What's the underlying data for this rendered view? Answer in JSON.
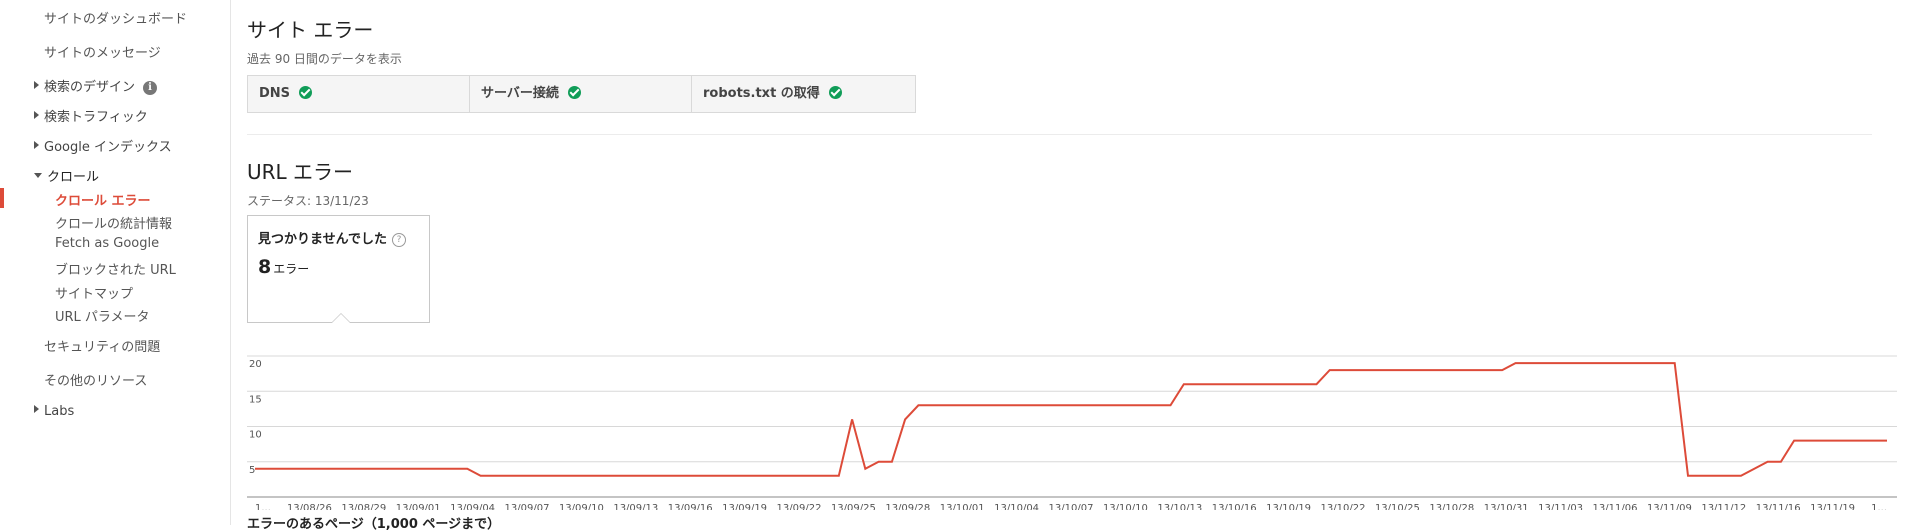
{
  "sidebar": {
    "top_items": [
      "サイトのダッシュボード",
      "サイトのメッセージ"
    ],
    "search_design": "検索のデザイン",
    "search_traffic": "検索トラフィック",
    "google_index": "Google インデックス",
    "crawl": "クロール",
    "crawl_sub": [
      "クロール エラー",
      "クロールの統計情報",
      "Fetch as Google",
      "ブロックされた URL",
      "サイトマップ",
      "URL パラメータ"
    ],
    "security": "セキュリティの問題",
    "other_resources": "その他のリソース",
    "labs": "Labs"
  },
  "site_errors": {
    "title": "サイト エラー",
    "subtitle": "過去 90 日間のデータを表示",
    "cells": [
      "DNS",
      "サーバー接続",
      "robots.txt の取得"
    ]
  },
  "url_errors": {
    "title": "URL エラー",
    "status": "ステータス: 13/11/23",
    "card_title": "見つかりませんでした",
    "card_count": "8",
    "card_count_unit": "エラー"
  },
  "colors": {
    "line": "#dd4b39",
    "active": "#dd4b39",
    "check": "#109d58"
  },
  "chart_data": {
    "type": "line",
    "ylim": [
      0,
      20
    ],
    "yticks": [
      5,
      10,
      15,
      20
    ],
    "xtick_labels": [
      "1...",
      "13/08/26",
      "13/08/29",
      "13/09/01",
      "13/09/04",
      "13/09/07",
      "13/09/10",
      "13/09/13",
      "13/09/16",
      "13/09/19",
      "13/09/22",
      "13/09/25",
      "13/09/28",
      "13/10/01",
      "13/10/04",
      "13/10/07",
      "13/10/10",
      "13/10/13",
      "13/10/16",
      "13/10/19",
      "13/10/22",
      "13/10/25",
      "13/10/28",
      "13/10/31",
      "13/11/03",
      "13/11/06",
      "13/11/09",
      "13/11/12",
      "13/11/16",
      "13/11/19",
      "1..."
    ],
    "series": [
      {
        "values": [
          4,
          4,
          4,
          4,
          4,
          4,
          4,
          4,
          4,
          4,
          4,
          4,
          4,
          4,
          4,
          4,
          4,
          3,
          3,
          3,
          3,
          3,
          3,
          3,
          3,
          3,
          3,
          3,
          3,
          3,
          3,
          3,
          3,
          3,
          3,
          3,
          3,
          3,
          3,
          3,
          3,
          3,
          3,
          3,
          3,
          11,
          4,
          5,
          5,
          11,
          13,
          13,
          13,
          13,
          13,
          13,
          13,
          13,
          13,
          13,
          13,
          13,
          13,
          13,
          13,
          13,
          13,
          13,
          13,
          13,
          16,
          16,
          16,
          16,
          16,
          16,
          16,
          16,
          16,
          16,
          16,
          18,
          18,
          18,
          18,
          18,
          18,
          18,
          18,
          18,
          18,
          18,
          18,
          18,
          18,
          19,
          19,
          19,
          19,
          19,
          19,
          19,
          19,
          19,
          19,
          19,
          19,
          19,
          3,
          3,
          3,
          3,
          3,
          4,
          5,
          5,
          8,
          8,
          8,
          8,
          8,
          8,
          8,
          8
        ]
      }
    ],
    "xlabel": "エラーのあるページ（1,000 ページまで）"
  }
}
